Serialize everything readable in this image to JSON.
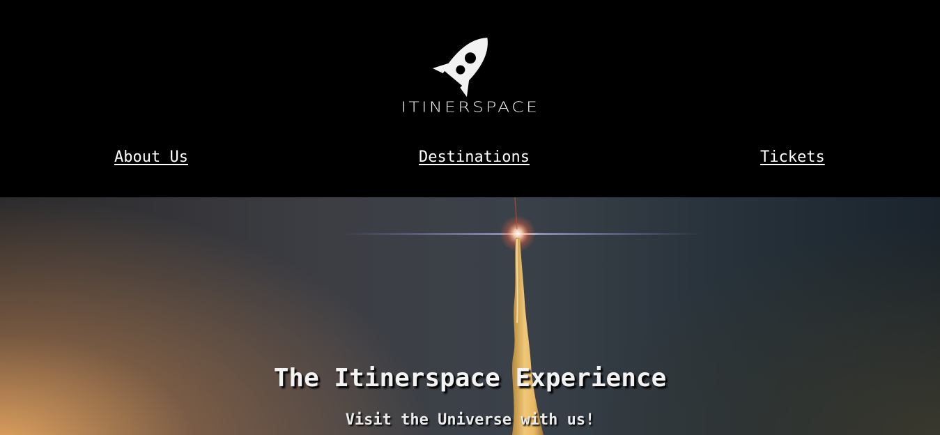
{
  "brand": {
    "logo_text": "ITINERSPACE",
    "logo_icon": "rocket-icon"
  },
  "nav": {
    "items": [
      {
        "label": "About Us"
      },
      {
        "label": "Destinations"
      },
      {
        "label": "Tickets"
      }
    ]
  },
  "hero": {
    "title": "The Itinerspace Experience",
    "subtitle": "Visit the Universe with us!"
  },
  "colors": {
    "header_bg": "#000000",
    "nav_text": "#ffffff",
    "hero_text": "#f3f3f3"
  }
}
